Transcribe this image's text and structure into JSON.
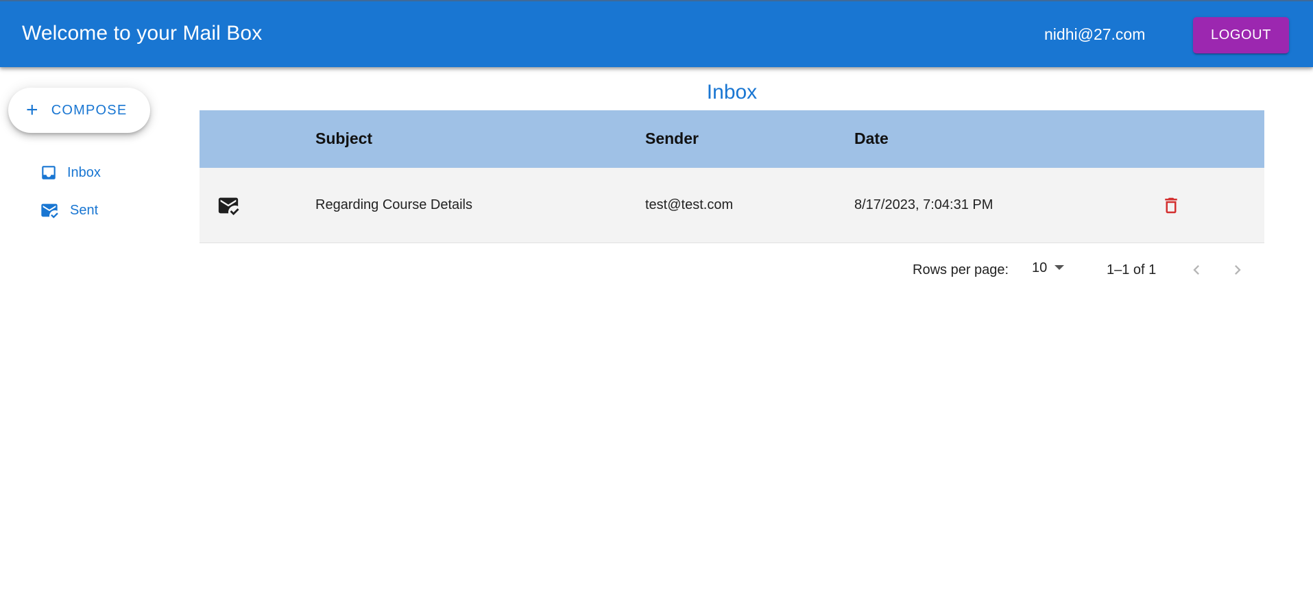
{
  "header": {
    "title": "Welcome to your Mail Box",
    "user_email": "nidhi@27.com",
    "logout_label": "LOGOUT"
  },
  "sidebar": {
    "compose_label": "COMPOSE",
    "items": [
      {
        "label": "Inbox",
        "icon": "inbox-icon"
      },
      {
        "label": "Sent",
        "icon": "mark-email-read-icon"
      }
    ]
  },
  "main": {
    "title": "Inbox",
    "table": {
      "headers": [
        "",
        "Subject",
        "Sender",
        "Date",
        ""
      ],
      "rows": [
        {
          "icon": "mark-email-read-icon",
          "subject": "Regarding Course Details",
          "sender": "test@test.com",
          "date": "8/17/2023, 7:04:31 PM",
          "action_icon": "delete-icon"
        }
      ]
    },
    "pagination": {
      "rows_per_page_label": "Rows per page:",
      "rows_per_page_value": "10",
      "range_text": "1–1 of 1"
    }
  },
  "colors": {
    "primary": "#1976d2",
    "logout": "#9c27b0",
    "table_header": "#9fc1e6",
    "row_bg": "#f3f3f3",
    "delete": "#d32f2f"
  }
}
